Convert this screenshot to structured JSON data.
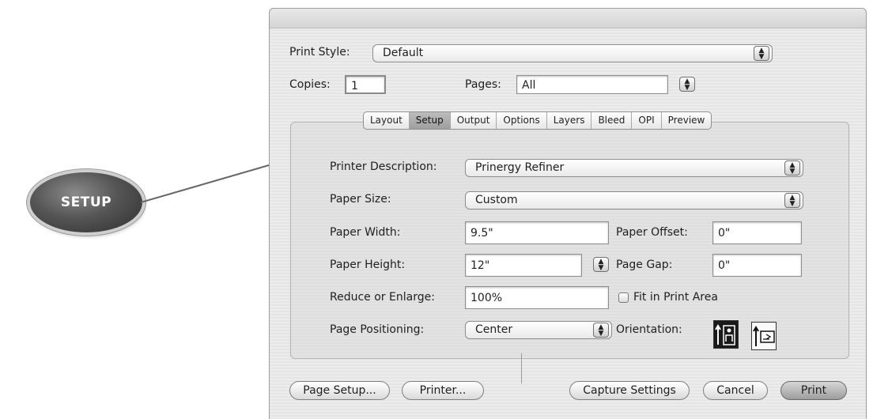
{
  "callout": {
    "label": "SETUP"
  },
  "dialog": {
    "print_style_label": "Print Style:",
    "print_style_value": "Default",
    "copies_label": "Copies:",
    "copies_value": "1",
    "pages_label": "Pages:",
    "pages_value": "All",
    "tabs": [
      "Layout",
      "Setup",
      "Output",
      "Options",
      "Layers",
      "Bleed",
      "OPI",
      "Preview"
    ],
    "selected_tab": "Setup",
    "setup": {
      "printer_description_label": "Printer Description:",
      "printer_description_value": "Prinergy Refiner",
      "paper_size_label": "Paper Size:",
      "paper_size_value": "Custom",
      "paper_width_label": "Paper Width:",
      "paper_width_value": "9.5\"",
      "paper_offset_label": "Paper Offset:",
      "paper_offset_value": "0\"",
      "paper_height_label": "Paper Height:",
      "paper_height_value": "12\"",
      "page_gap_label": "Page Gap:",
      "page_gap_value": "0\"",
      "reduce_enlarge_label": "Reduce or Enlarge:",
      "reduce_enlarge_value": "100%",
      "fit_in_print_area_label": "Fit in Print Area",
      "fit_in_print_area_checked": false,
      "page_positioning_label": "Page Positioning:",
      "page_positioning_value": "Center",
      "orientation_label": "Orientation:",
      "orientation_selected": "portrait"
    },
    "buttons": {
      "page_setup": "Page Setup...",
      "printer": "Printer...",
      "capture_settings": "Capture Settings",
      "cancel": "Cancel",
      "print": "Print"
    }
  }
}
